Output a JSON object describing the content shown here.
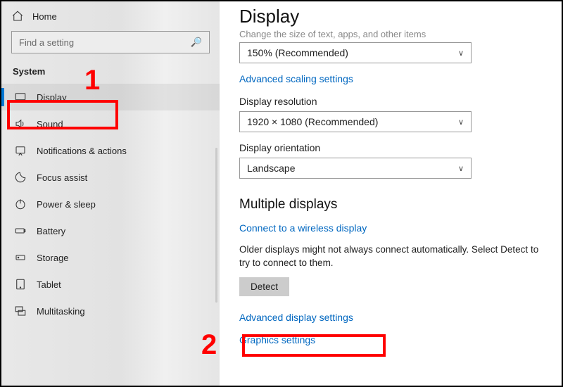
{
  "sidebar": {
    "home": "Home",
    "search_placeholder": "Find a setting",
    "group": "System",
    "items": [
      {
        "label": "Display"
      },
      {
        "label": "Sound"
      },
      {
        "label": "Notifications & actions"
      },
      {
        "label": "Focus assist"
      },
      {
        "label": "Power & sleep"
      },
      {
        "label": "Battery"
      },
      {
        "label": "Storage"
      },
      {
        "label": "Tablet"
      },
      {
        "label": "Multitasking"
      }
    ]
  },
  "main": {
    "title": "Display",
    "truncated_line": "Change the size of text, apps, and other items",
    "scale_value": "150% (Recommended)",
    "adv_scaling_link": "Advanced scaling settings",
    "resolution_label": "Display resolution",
    "resolution_value": "1920 × 1080 (Recommended)",
    "orientation_label": "Display orientation",
    "orientation_value": "Landscape",
    "multiple_h": "Multiple displays",
    "wireless_link": "Connect to a wireless display",
    "older_text": "Older displays might not always connect automatically. Select Detect to try to connect to them.",
    "detect_btn": "Detect",
    "adv_display_link": "Advanced display settings",
    "graphics_link": "Graphics settings"
  },
  "annotations": {
    "n1": "1",
    "n2": "2"
  }
}
